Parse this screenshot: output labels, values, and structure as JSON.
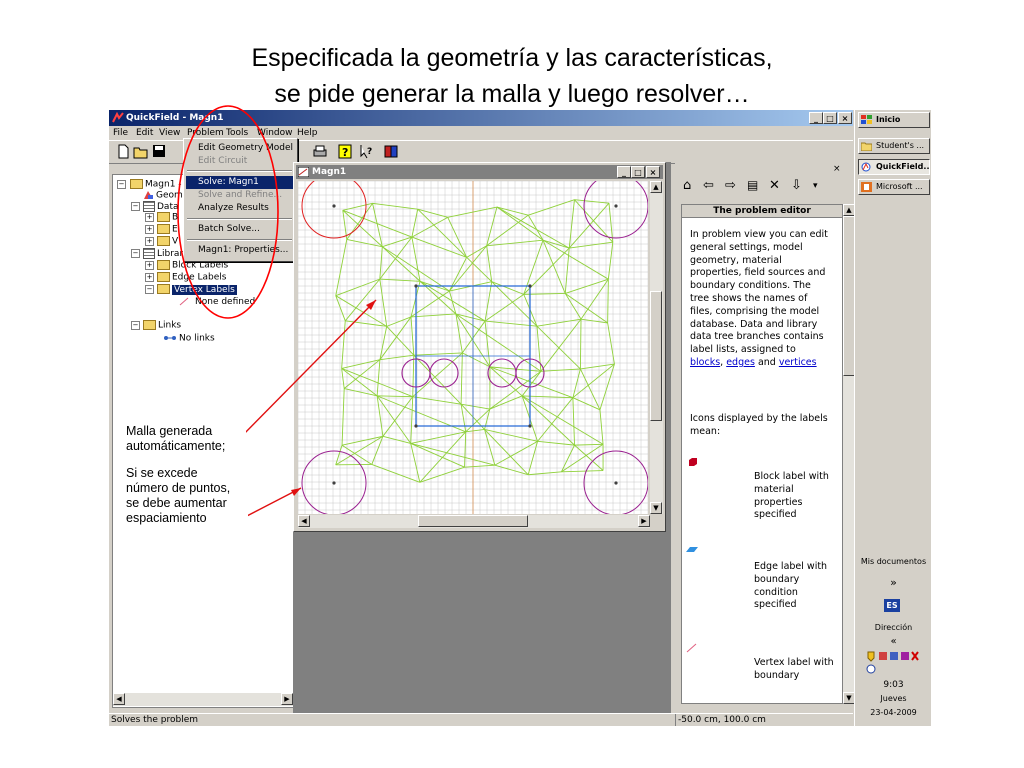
{
  "slide": {
    "title_line1": "Especificada la geometría y las características,",
    "title_line2": "se pide generar la malla y luego resolver…"
  },
  "app": {
    "title": "QuickField - Magn1",
    "window_controls": [
      "_",
      "□",
      "×"
    ],
    "menu": [
      "File",
      "Edit",
      "View",
      "Problem",
      "Tools",
      "Window",
      "Help"
    ],
    "toolbar_icons": [
      "new-icon",
      "open-icon",
      "save-icon",
      "print-icon",
      "help-icon",
      "context-help-icon",
      "book-icon"
    ]
  },
  "problem_menu": {
    "items": [
      {
        "label": "Edit Geometry Model",
        "state": "normal"
      },
      {
        "label": "Edit Circuit",
        "state": "disabled"
      },
      {
        "label": "Solve: Magn1",
        "state": "highlighted"
      },
      {
        "label": "Solve and Refine...",
        "state": "disabled"
      },
      {
        "label": "Analyze Results",
        "state": "normal"
      },
      {
        "label": "Batch Solve...",
        "state": "normal"
      },
      {
        "label": "Magn1: Properties...",
        "state": "normal"
      }
    ]
  },
  "tree": {
    "items": [
      {
        "label": "Magn1 - r",
        "level": 0
      },
      {
        "label": "Geom",
        "level": 1
      },
      {
        "label": "Data",
        "level": 1
      },
      {
        "label": "B",
        "level": 2
      },
      {
        "label": "E",
        "level": 2
      },
      {
        "label": "V",
        "level": 2
      },
      {
        "label": "Library Data: Magn1Ho u7s",
        "level": 0
      },
      {
        "label": "Block Labels",
        "level": 1
      },
      {
        "label": "Edge Labels",
        "level": 1
      },
      {
        "label": "Vertex Labels",
        "level": 1
      },
      {
        "label": "None defined",
        "level": 2
      },
      {
        "label": "Links",
        "level": 0
      },
      {
        "label": "No links",
        "level": 1
      }
    ]
  },
  "document": {
    "title": "Magn1"
  },
  "help": {
    "heading": "The problem editor",
    "para1": "In problem view you can edit general settings, model geometry, material properties, field sources and boundary conditions. The tree shows the names of files, comprising the model database. Data and library data tree branches contains label lists, assigned to",
    "link_blocks": "blocks",
    "link_edges": "edges",
    "and_text": "and",
    "link_vertices": "vertices",
    "para2": "Icons displayed by the labels mean:",
    "block_label": "Block label with material properties specified",
    "edge_label": "Edge label with boundary condition specified",
    "vertex_label": "Vertex label with boundary"
  },
  "status": {
    "left": "Solves the problem",
    "coords": "-50.0 cm, 100.0 cm"
  },
  "taskbar": {
    "start": "Inicio",
    "buttons": [
      "Student's ...",
      "QuickField...",
      "Microsoft ..."
    ],
    "mis_documentos": "Mis documentos",
    "chevron": "»",
    "lang": "ES",
    "direccion": "Dirección",
    "up_chevron": "«",
    "time": "9:03",
    "day": "Jueves",
    "date": "23-04-2009"
  },
  "annotations": {
    "mesh_line1": "Malla generada",
    "mesh_line2": "automáticamente;",
    "exceed_line1": "Si se excede",
    "exceed_line2": "número de puntos,",
    "exceed_line3": "se debe aumentar",
    "exceed_line4": "espaciamiento"
  },
  "colors": {
    "mesh": "#8fd13a",
    "boundary": "#2f6fd8",
    "arcs_red": "#e02020",
    "arcs_purple": "#9a2090",
    "highlight_oval": "#ff0000",
    "arrow": "#e01010"
  }
}
